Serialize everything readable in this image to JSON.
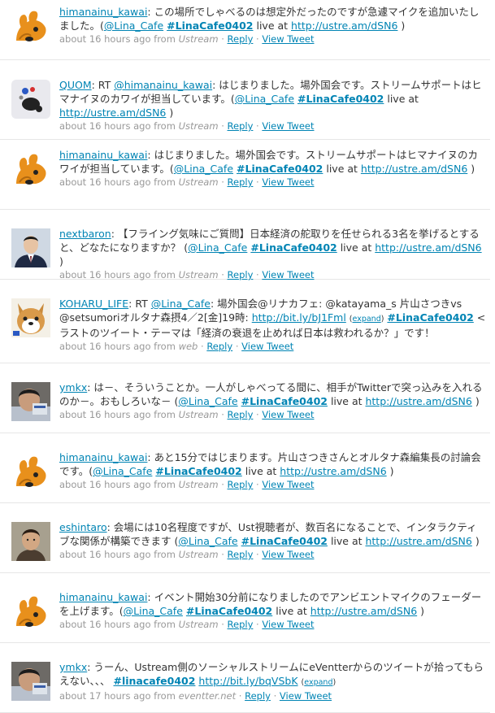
{
  "labels": {
    "reply": "Reply",
    "view_tweet": "View Tweet",
    "from": "from"
  },
  "colors": {
    "link": "#0084b4",
    "meta": "#999999",
    "text": "#333333",
    "divider": "#e6e6e6"
  },
  "tweets": [
    {
      "avatar": "dog-mascot-avatar",
      "parts": [
        {
          "t": "user",
          "v": "himanainu_kawai"
        },
        {
          "t": "text",
          "v": ": この場所でしゃべるのは想定外だったのですが急遽マイクを追加いたしました。("
        },
        {
          "t": "mention",
          "v": "@Lina_Cafe"
        },
        {
          "t": "text",
          "v": " "
        },
        {
          "t": "hashtag",
          "v": "#LinaCafe0402"
        },
        {
          "t": "text",
          "v": " live at "
        },
        {
          "t": "link",
          "v": "http://ustre.am/dSN6"
        },
        {
          "t": "text",
          "v": " )"
        }
      ],
      "time": "about 16 hours ago",
      "source": "Ustream"
    },
    {
      "avatar": "quom-logo-avatar",
      "parts": [
        {
          "t": "user",
          "v": "QUOM"
        },
        {
          "t": "text",
          "v": ": RT "
        },
        {
          "t": "mention",
          "v": "@himanainu_kawai"
        },
        {
          "t": "text",
          "v": ": はじまりました。場外国会です。ストリームサポートはヒマナイヌのカワイが担当しています。("
        },
        {
          "t": "mention",
          "v": "@Lina_Cafe"
        },
        {
          "t": "text",
          "v": " "
        },
        {
          "t": "hashtag",
          "v": "#LinaCafe0402"
        },
        {
          "t": "text",
          "v": " live at "
        },
        {
          "t": "link",
          "v": "http://ustre.am/dSN6"
        },
        {
          "t": "text",
          "v": " )"
        }
      ],
      "time": "about 16 hours ago",
      "source": "Ustream"
    },
    {
      "avatar": "dog-mascot-avatar",
      "parts": [
        {
          "t": "user",
          "v": "himanainu_kawai"
        },
        {
          "t": "text",
          "v": ": はじまりました。場外国会です。ストリームサポートはヒマナイヌのカワイが担当しています。("
        },
        {
          "t": "mention",
          "v": "@Lina_Cafe"
        },
        {
          "t": "text",
          "v": " "
        },
        {
          "t": "hashtag",
          "v": "#LinaCafe0402"
        },
        {
          "t": "text",
          "v": " live at "
        },
        {
          "t": "link",
          "v": "http://ustre.am/dSN6"
        },
        {
          "t": "text",
          "v": " )"
        }
      ],
      "time": "about 16 hours ago",
      "source": "Ustream"
    },
    {
      "avatar": "man-in-suit-avatar",
      "parts": [
        {
          "t": "user",
          "v": "nextbaron"
        },
        {
          "t": "text",
          "v": ": 【フライング気味にご質問】日本経済の舵取りを任せられる3名を挙げるとすると、どなたになりますか？ ("
        },
        {
          "t": "mention",
          "v": "@Lina_Cafe"
        },
        {
          "t": "text",
          "v": " "
        },
        {
          "t": "hashtag",
          "v": "#LinaCafe0402"
        },
        {
          "t": "text",
          "v": " live at "
        },
        {
          "t": "link",
          "v": "http://ustre.am/dSN6"
        },
        {
          "t": "text",
          "v": " )"
        }
      ],
      "time": "about 16 hours ago",
      "source": "Ustream"
    },
    {
      "avatar": "shiba-dog-avatar",
      "parts": [
        {
          "t": "user",
          "v": "KOHARU_LIFE"
        },
        {
          "t": "text",
          "v": ": RT "
        },
        {
          "t": "mention",
          "v": "@Lina_Cafe"
        },
        {
          "t": "text",
          "v": ": 場外国会@リナカフェ: @katayama_s 片山さつきvs @setsumoriオルタナ森摂4／2[金]19時: "
        },
        {
          "t": "link",
          "v": "http://bit.ly/bJ1Fml"
        },
        {
          "t": "text",
          "v": " "
        },
        {
          "t": "expand",
          "v": "expand"
        },
        {
          "t": "text",
          "v": " "
        },
        {
          "t": "hashtag",
          "v": "#LinaCafe0402"
        },
        {
          "t": "text",
          "v": " <ラストのツイート・テーマは「経済の衰退を止めれば日本は救われるか？」です！"
        }
      ],
      "time": "about 16 hours ago",
      "source": "web"
    },
    {
      "avatar": "person-photo-avatar",
      "parts": [
        {
          "t": "user",
          "v": "ymkx"
        },
        {
          "t": "text",
          "v": ": は－、そういうことか。一人がしゃべってる間に、相手がTwitterで突っ込みを入れるのか－。おもしろいな－ ("
        },
        {
          "t": "mention",
          "v": "@Lina_Cafe"
        },
        {
          "t": "text",
          "v": " "
        },
        {
          "t": "hashtag",
          "v": "#LinaCafe0402"
        },
        {
          "t": "text",
          "v": " live at "
        },
        {
          "t": "link",
          "v": "http://ustre.am/dSN6"
        },
        {
          "t": "text",
          "v": " )"
        }
      ],
      "time": "about 16 hours ago",
      "source": "Ustream"
    },
    {
      "avatar": "dog-mascot-avatar",
      "parts": [
        {
          "t": "user",
          "v": "himanainu_kawai"
        },
        {
          "t": "text",
          "v": ": あと15分ではじまります。片山さつきさんとオルタナ森編集長の討論会です。("
        },
        {
          "t": "mention",
          "v": "@Lina_Cafe"
        },
        {
          "t": "text",
          "v": " "
        },
        {
          "t": "hashtag",
          "v": "#LinaCafe0402"
        },
        {
          "t": "text",
          "v": " live at "
        },
        {
          "t": "link",
          "v": "http://ustre.am/dSN6"
        },
        {
          "t": "text",
          "v": " )"
        }
      ],
      "time": "about 16 hours ago",
      "source": "Ustream"
    },
    {
      "avatar": "man-portrait-avatar",
      "parts": [
        {
          "t": "user",
          "v": "eshintaro"
        },
        {
          "t": "text",
          "v": ": 会場には10名程度ですが、Ust視聴者が、数百名になることで、インタラクティブな関係が構築できます ("
        },
        {
          "t": "mention",
          "v": "@Lina_Cafe"
        },
        {
          "t": "text",
          "v": " "
        },
        {
          "t": "hashtag",
          "v": "#LinaCafe0402"
        },
        {
          "t": "text",
          "v": " live at "
        },
        {
          "t": "link",
          "v": "http://ustre.am/dSN6"
        },
        {
          "t": "text",
          "v": " )"
        }
      ],
      "time": "about 16 hours ago",
      "source": "Ustream"
    },
    {
      "avatar": "dog-mascot-avatar",
      "parts": [
        {
          "t": "user",
          "v": "himanainu_kawai"
        },
        {
          "t": "text",
          "v": ": イベント開始30分前になりましたのでアンビエントマイクのフェーダーを上げます。("
        },
        {
          "t": "mention",
          "v": "@Lina_Cafe"
        },
        {
          "t": "text",
          "v": " "
        },
        {
          "t": "hashtag",
          "v": "#LinaCafe0402"
        },
        {
          "t": "text",
          "v": " live at "
        },
        {
          "t": "link",
          "v": "http://ustre.am/dSN6"
        },
        {
          "t": "text",
          "v": " )"
        }
      ],
      "time": "about 16 hours ago",
      "source": "Ustream"
    },
    {
      "avatar": "person-photo-avatar",
      "parts": [
        {
          "t": "user",
          "v": "ymkx"
        },
        {
          "t": "text",
          "v": ": うーん、Ustream側のソーシャルストリームにeVentterからのツイートが拾ってもらえない、、、 "
        },
        {
          "t": "hashtag",
          "v": "#linacafe0402"
        },
        {
          "t": "text",
          "v": " "
        },
        {
          "t": "link",
          "v": "http://bit.ly/bqVSbK"
        },
        {
          "t": "text",
          "v": " "
        },
        {
          "t": "expand",
          "v": "expand"
        }
      ],
      "time": "about 17 hours ago",
      "source": "eventter.net"
    }
  ]
}
